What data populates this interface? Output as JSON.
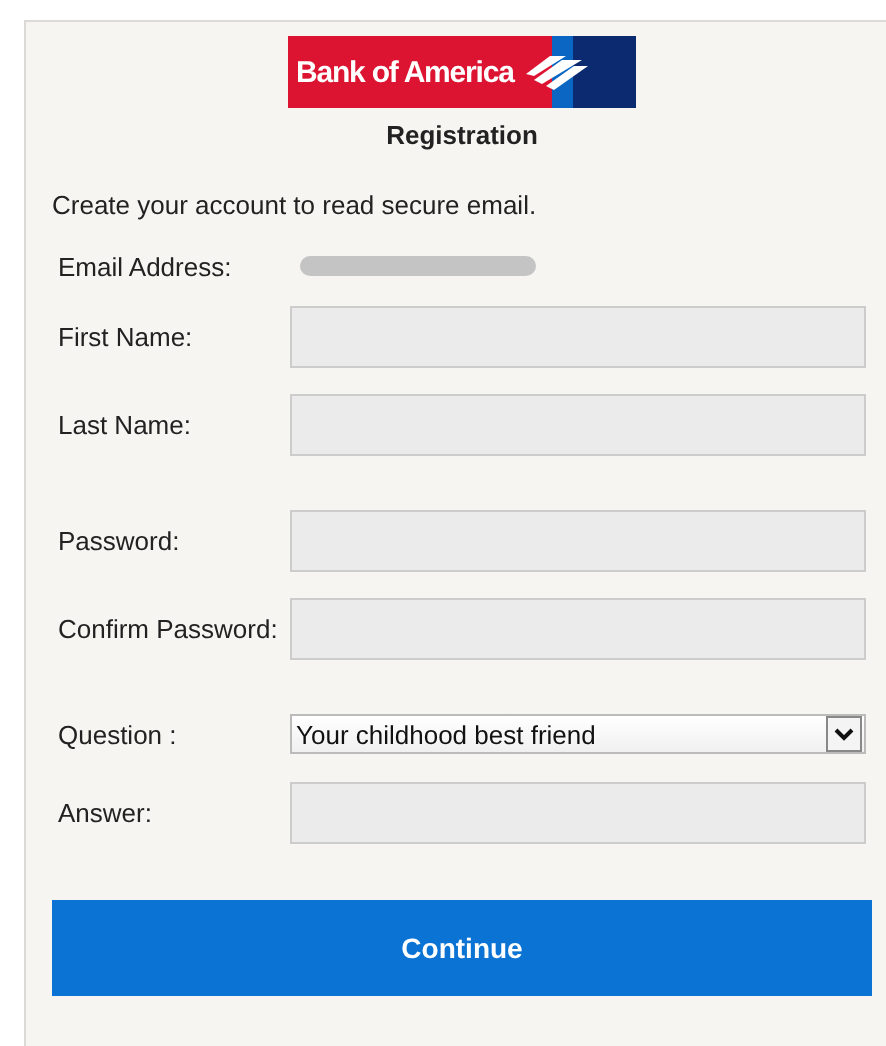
{
  "logo": {
    "text": "Bank of America"
  },
  "title": "Registration",
  "intro": "Create your account to read secure email.",
  "groups": [
    [
      {
        "label": "Email Address:",
        "kind": "redacted"
      },
      {
        "label": "First Name:",
        "kind": "input"
      },
      {
        "label": "Last Name:",
        "kind": "input"
      }
    ],
    [
      {
        "label": "Password:",
        "kind": "input"
      },
      {
        "label": "Confirm Password:",
        "kind": "input"
      }
    ],
    [
      {
        "label": "Question :",
        "kind": "select",
        "value": "Your childhood best friend"
      },
      {
        "label": "Answer:",
        "kind": "input"
      }
    ]
  ],
  "button": "Continue"
}
